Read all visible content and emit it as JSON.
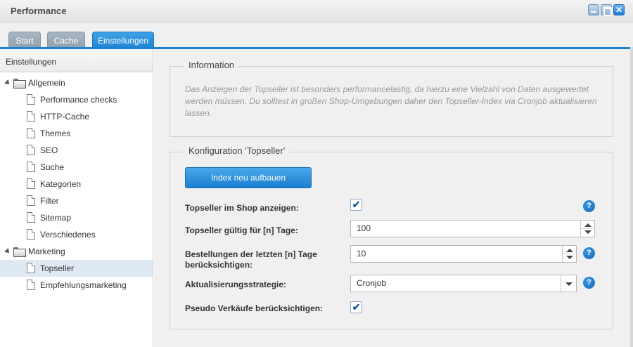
{
  "window": {
    "title": "Performance"
  },
  "tabs": [
    {
      "label": "Start"
    },
    {
      "label": "Cache"
    },
    {
      "label": "Einstellungen"
    }
  ],
  "sidebar": {
    "header": "Einstellungen",
    "groups": [
      {
        "label": "Allgemein",
        "items": [
          {
            "label": "Performance checks"
          },
          {
            "label": "HTTP-Cache"
          },
          {
            "label": "Themes"
          },
          {
            "label": "SEO"
          },
          {
            "label": "Suche"
          },
          {
            "label": "Kategorien"
          },
          {
            "label": "Filter"
          },
          {
            "label": "Sitemap"
          },
          {
            "label": "Verschiedenes"
          }
        ]
      },
      {
        "label": "Marketing",
        "items": [
          {
            "label": "Topseller"
          },
          {
            "label": "Empfehlungsmarketing"
          }
        ]
      }
    ],
    "selected": "Topseller"
  },
  "info": {
    "legend": "Information",
    "text": "Das Anzeigen der Topseller ist besonders performancelastig, da hierzu eine Vielzahl von Daten ausgewertet werden müssen. Du solltest in großen Shop-Umgebungen daher den Topseller-Index via Cronjob aktualisieren lassen."
  },
  "config": {
    "legend": "Konfiguration 'Topseller'",
    "rebuild_button": "Index neu aufbauen",
    "fields": {
      "show_in_shop": {
        "label": "Topseller im Shop anzeigen:",
        "checked": true
      },
      "valid_days": {
        "label": "Topseller gültig für [n] Tage:",
        "value": "100"
      },
      "orders_days": {
        "label": "Bestellungen der letzten [n] Tage berücksichtigen:",
        "value": "10"
      },
      "strategy": {
        "label": "Aktualisierungsstrategie:",
        "value": "Cronjob"
      },
      "pseudo_sales": {
        "label": "Pseudo Verkäufe berücksichtigen:",
        "checked": true
      }
    }
  },
  "icons": {
    "check": "✔",
    "help": "?"
  }
}
